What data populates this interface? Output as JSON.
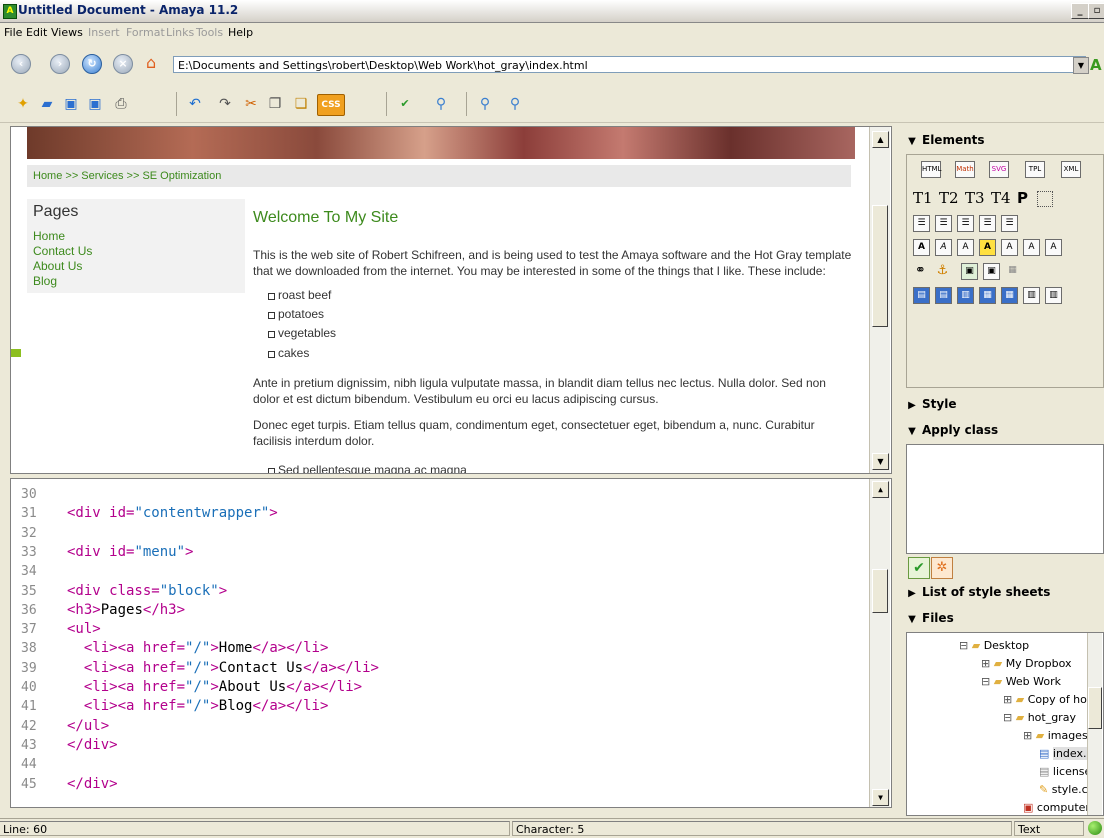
{
  "window": {
    "title": "Untitled Document - Amaya 11.2"
  },
  "menu": [
    "File",
    "Edit",
    "Views",
    "Insert",
    "Format",
    "Links",
    "Tools",
    "Help"
  ],
  "address": {
    "url": "E:\\Documents and Settings\\robert\\Desktop\\Web Work\\hot_gray\\index.html"
  },
  "page": {
    "breadcrumb": "Home >> Services >> SE Optimization",
    "pages_heading": "Pages",
    "nav_links": [
      "Home",
      "Contact Us",
      "About Us",
      "Blog"
    ],
    "welcome": "Welcome To My Site",
    "intro": "This is the web site of Robert Schifreen, and is being used to test the Amaya software and the Hot Gray template that we downloaded from the internet. You may be interested in some of the things that I like. These include:",
    "likes": [
      "roast beef",
      "potatoes",
      "vegetables",
      "cakes"
    ],
    "para2": "Ante in pretium dignissim, nibh ligula vulputate massa, in blandit diam tellus nec lectus. Nulla dolor. Sed non dolor et est dictum bibendum. Vestibulum eu orci eu lacus adipiscing cursus.",
    "para3": "Donec eget turpis. Etiam tellus quam, condimentum eget, consectetuer eget, bibendum a, nunc. Curabitur facilisis interdum dolor.",
    "partial_item": "Sed pellentesque magna ac magna"
  },
  "source": {
    "lines": [
      {
        "num": "30",
        "code": ""
      },
      {
        "num": "31",
        "code": "<div id=\"contentwrapper\">"
      },
      {
        "num": "32",
        "code": ""
      },
      {
        "num": "33",
        "code": "<div id=\"menu\">"
      },
      {
        "num": "34",
        "code": ""
      },
      {
        "num": "35",
        "code": "<div class=\"block\">"
      },
      {
        "num": "36",
        "code": "<h3>Pages</h3>"
      },
      {
        "num": "37",
        "code": "<ul>"
      },
      {
        "num": "38",
        "code": "  <li><a href=\"/\">Home</a></li>"
      },
      {
        "num": "39",
        "code": "  <li><a href=\"/\">Contact Us</a></li>"
      },
      {
        "num": "40",
        "code": "  <li><a href=\"/\">About Us</a></li>"
      },
      {
        "num": "41",
        "code": "  <li><a href=\"/\">Blog</a></li>"
      },
      {
        "num": "42",
        "code": "</ul>"
      },
      {
        "num": "43",
        "code": "</div>"
      },
      {
        "num": "44",
        "code": ""
      },
      {
        "num": "45",
        "code": "</div>"
      }
    ]
  },
  "panel": {
    "elements": "Elements",
    "element_tabs": [
      "HTML",
      "Math",
      "SVG",
      "TPL",
      "XML"
    ],
    "headings": [
      "T1",
      "T2",
      "T3",
      "T4",
      "P"
    ],
    "style": "Style",
    "apply_class": "Apply class",
    "style_sheets": "List of style sheets",
    "files": "Files",
    "tree": [
      "Desktop",
      "My Dropbox",
      "Web Work",
      "Copy of ho",
      "hot_gray",
      "images",
      "index.h",
      "license.",
      "style.cs",
      "computer.jp"
    ]
  },
  "status": {
    "line": "Line: 60",
    "character": "Character: 5",
    "mode": "Text"
  }
}
